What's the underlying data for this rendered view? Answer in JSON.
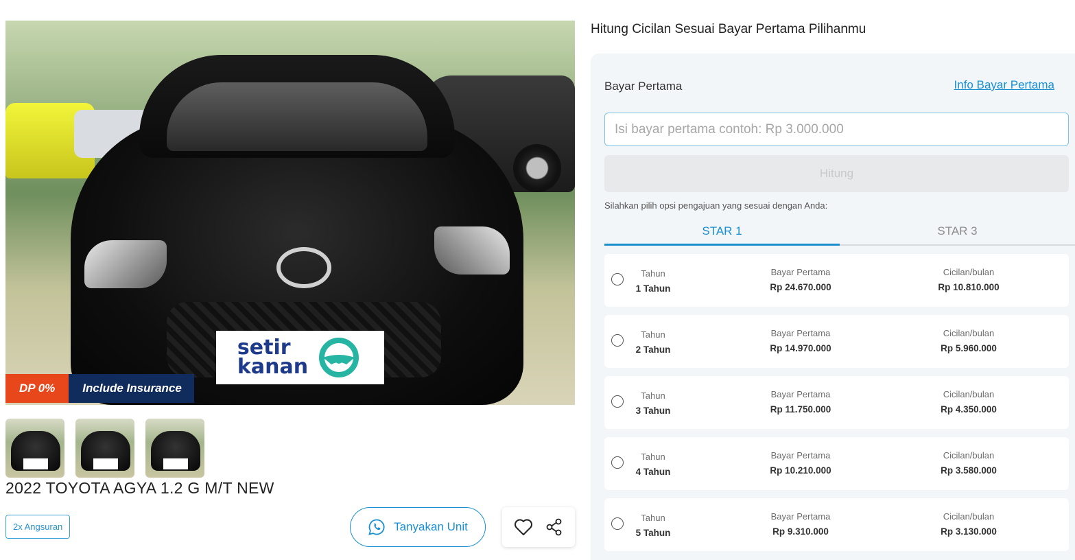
{
  "listing": {
    "badge_dp": "DP 0%",
    "badge_insurance": "Include Insurance",
    "watermark": "setir kanan",
    "title": "2022 TOYOTA AGYA 1.2 G M/T NEW",
    "chip": "2x Angsuran",
    "ask_button": "Tanyakan Unit",
    "thumbnails": 3
  },
  "calculator": {
    "heading": "Hitung Cicilan Sesuai Bayar Pertama Pilihanmu",
    "bp_label": "Bayar Pertama",
    "bp_info_link": "Info Bayar Pertama",
    "input_placeholder": "Isi bayar pertama contoh: Rp 3.000.000",
    "input_value": "",
    "calc_button": "Hitung",
    "instruction": "Silahkan pilih opsi pengajuan yang sesuai dengan Anda:",
    "tabs": [
      {
        "label": "STAR 1",
        "active": true
      },
      {
        "label": "STAR 3",
        "active": false
      }
    ],
    "options": [
      {
        "tenor_label": "Tahun",
        "tenor": "1 Tahun",
        "bp_label": "Bayar Pertama",
        "bp": "Rp 24.670.000",
        "inst_label": "Cicilan/bulan",
        "inst": "Rp 10.810.000"
      },
      {
        "tenor_label": "Tahun",
        "tenor": "2 Tahun",
        "bp_label": "Bayar Pertama",
        "bp": "Rp 14.970.000",
        "inst_label": "Cicilan/bulan",
        "inst": "Rp 5.960.000"
      },
      {
        "tenor_label": "Tahun",
        "tenor": "3 Tahun",
        "bp_label": "Bayar Pertama",
        "bp": "Rp 11.750.000",
        "inst_label": "Cicilan/bulan",
        "inst": "Rp 4.350.000"
      },
      {
        "tenor_label": "Tahun",
        "tenor": "4 Tahun",
        "bp_label": "Bayar Pertama",
        "bp": "Rp 10.210.000",
        "inst_label": "Cicilan/bulan",
        "inst": "Rp 3.580.000"
      },
      {
        "tenor_label": "Tahun",
        "tenor": "5 Tahun",
        "bp_label": "Bayar Pertama",
        "bp": "Rp 9.310.000",
        "inst_label": "Cicilan/bulan",
        "inst": "Rp 3.130.000"
      }
    ]
  },
  "colors": {
    "accent": "#1a8fd0",
    "dp_badge": "#e8471c",
    "insurance_badge": "#102c5c",
    "panel_bg": "#f3f6f9"
  },
  "icons": [
    "whatsapp-icon",
    "heart-icon",
    "share-icon",
    "steering-wheel-icon"
  ]
}
